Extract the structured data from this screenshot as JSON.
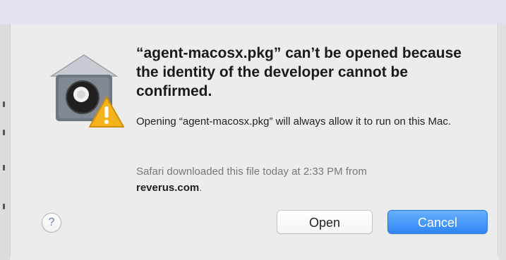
{
  "dialog": {
    "icon": "gatekeeper-house-icon",
    "warning_badge_icon": "warning-triangle-icon",
    "title": "“agent-macosx.pkg” can’t be opened because the identity of the developer cannot be confirmed.",
    "info": "Opening “agent-macosx.pkg” will always allow it to run on this Mac.",
    "source_prefix": "Safari downloaded this file today at 2:33 PM from",
    "source_domain": "reverus.com",
    "source_suffix": ".",
    "help_label": "?",
    "open_label": "Open",
    "cancel_label": "Cancel"
  },
  "colors": {
    "accent": "#2f86f3",
    "warning": "#f5b31b",
    "top_strip": "#e4e2f1",
    "dialog_bg": "#ececec"
  }
}
